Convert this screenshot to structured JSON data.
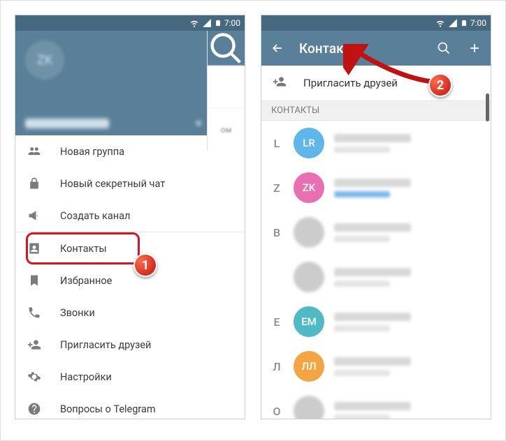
{
  "statusbar": {
    "time": "7:00"
  },
  "left": {
    "avatar_initials": "ZK",
    "menu": {
      "new_group": "Новая группа",
      "new_secret": "Новый секретный чат",
      "new_channel": "Создать канал",
      "contacts": "Контакты",
      "saved": "Избранное",
      "calls": "Звонки",
      "invite": "Пригласить друзей",
      "settings": "Настройки",
      "faq": "Вопросы о Telegram"
    },
    "chat_peek": "ом"
  },
  "right": {
    "appbar_title": "Контакты",
    "invite_label": "Пригласить друзей",
    "section_label": "КОНТАКТЫ",
    "rows": [
      {
        "letter": "L",
        "initials": "LR",
        "color": "#5fb6e8",
        "img": false,
        "online": false
      },
      {
        "letter": "Z",
        "initials": "ZK",
        "color": "#e86fb1",
        "img": false,
        "online": true
      },
      {
        "letter": "В",
        "initials": "",
        "color": "#bbb",
        "img": true,
        "online": false
      },
      {
        "letter": "",
        "initials": "",
        "color": "#bbb",
        "img": true,
        "online": false
      },
      {
        "letter": "Е",
        "initials": "ЕМ",
        "color": "#4fb9c4",
        "img": false,
        "online": false
      },
      {
        "letter": "Л",
        "initials": "ЛЛ",
        "color": "#f4a543",
        "img": false,
        "online": false
      },
      {
        "letter": "О",
        "initials": "",
        "color": "#bbb",
        "img": true,
        "online": false
      }
    ]
  },
  "annotations": {
    "badge1": "1",
    "badge2": "2"
  }
}
